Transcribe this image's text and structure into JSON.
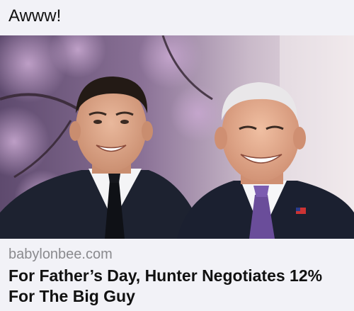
{
  "post": {
    "text": "Awww!"
  },
  "link_preview": {
    "domain": "babylonbee.com",
    "headline": "For Father’s Day, Hunter Negotiates 12% For The Big Guy",
    "image_alt": "Photo of two smiling men in dark suits and ties"
  },
  "colors": {
    "background": "#f2f2f7",
    "text": "#111111",
    "domain_text": "#8a8a8e"
  }
}
